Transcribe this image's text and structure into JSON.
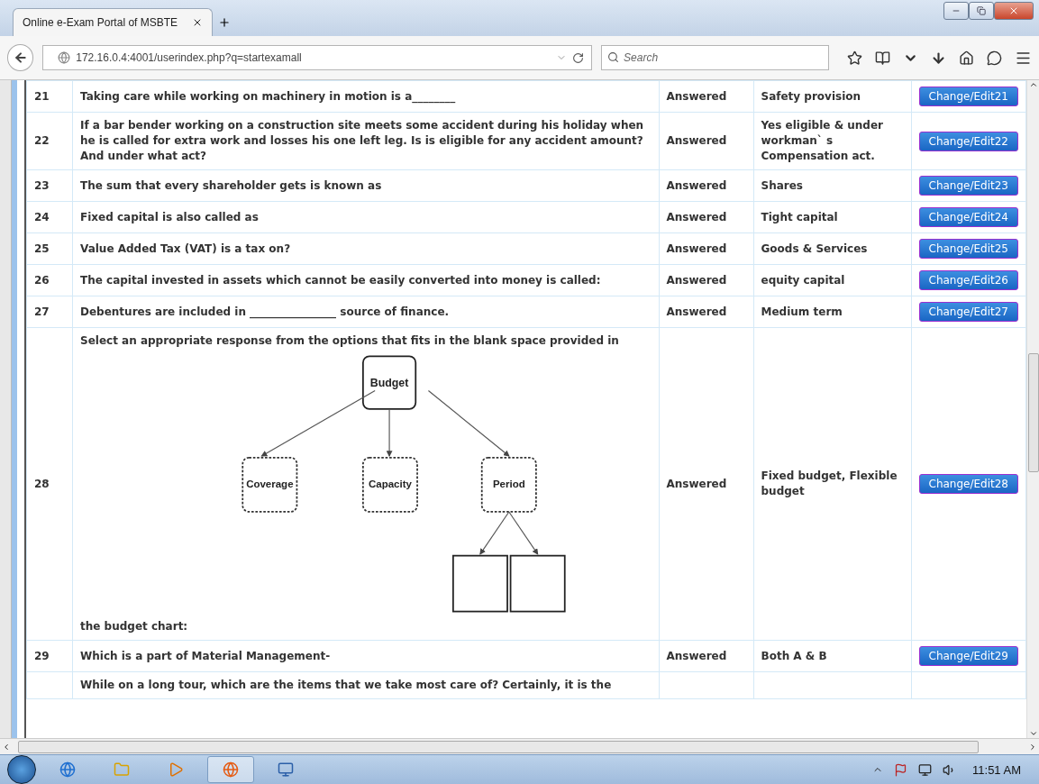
{
  "browser": {
    "tab_title": "Online e-Exam Portal of MSBTE",
    "url": "172.16.0.4:4001/userindex.php?q=startexamall",
    "search": {
      "placeholder": "Search"
    }
  },
  "questions": [
    {
      "kind": "text",
      "number": "21",
      "question": "Taking care while working on machinery in motion is a________",
      "status": "Answered",
      "answer": "Safety provision",
      "button": "Change/Edit21"
    },
    {
      "kind": "text",
      "number": "22",
      "question": "If a bar bender working on a construction site meets some accident during his holiday when he is called for extra work and losses his one left leg. Is is eligible for any accident amount? And under what act?",
      "status": "Answered",
      "answer": "Yes eligible & under workman` s Compensation act.",
      "button": "Change/Edit22"
    },
    {
      "kind": "text",
      "number": "23",
      "question": "The sum that every shareholder gets is known as",
      "status": "Answered",
      "answer": "Shares",
      "button": "Change/Edit23"
    },
    {
      "kind": "text",
      "number": "24",
      "question": "Fixed capital is also called as",
      "status": "Answered",
      "answer": "Tight capital",
      "button": "Change/Edit24"
    },
    {
      "kind": "text",
      "number": "25",
      "question": "Value Added Tax (VAT) is a tax on?",
      "status": "Answered",
      "answer": "Goods & Services",
      "button": "Change/Edit25"
    },
    {
      "kind": "text",
      "number": "26",
      "question": "The capital invested in assets which cannot be easily converted into money is called:",
      "status": "Answered",
      "answer": "equity capital",
      "button": "Change/Edit26"
    },
    {
      "kind": "text",
      "number": "27",
      "question": "Debentures are included in ________________ source of finance.",
      "status": "Answered",
      "answer": "Medium term",
      "button": "Change/Edit27"
    },
    {
      "kind": "diagram",
      "number": "28",
      "question": "Select an appropriate response from the options that fits in the blank space provided in",
      "question_after": "the budget chart:",
      "diagram": {
        "root": "Budget",
        "branches": [
          {
            "label": "Coverage"
          },
          {
            "label": "Capacity"
          },
          {
            "label": "Period",
            "children": [
              {
                "kind": "blank"
              },
              {
                "kind": "blank"
              }
            ]
          }
        ]
      },
      "status": "Answered",
      "answer": "Fixed budget, Flexible budget",
      "button": "Change/Edit28"
    },
    {
      "kind": "text",
      "number": "29",
      "question": "Which is a part of Material Management-",
      "status": "Answered",
      "answer": "Both A & B",
      "button": "Change/Edit29"
    },
    {
      "kind": "partial",
      "question": "While on a long tour, which are the items that we take most care of? Certainly, it is the"
    }
  ],
  "taskbar": {
    "clock": "11:51 AM"
  }
}
